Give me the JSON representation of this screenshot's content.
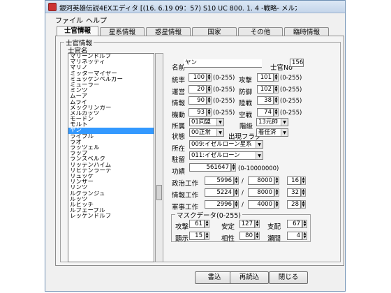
{
  "title": "銀河英雄伝説4EXエディタ [(16. 6.19 09：57) S10 UC 800. 1. 4 -戦略- メルカッ...",
  "menu": [
    "ファイル",
    "ヘルプ"
  ],
  "tabs": [
    "士官情報",
    "星系情報",
    "惑星情報",
    "国家",
    "その他",
    "臨時情報"
  ],
  "group_label": "士官情報",
  "list_header": "士官名",
  "officers": [
    "マリーンドルフ",
    "マリネッティ",
    "マリノ",
    "ミッターマイヤー",
    "ミュッケンベルガー",
    "ミューラー",
    "ミンツ",
    "ムーア",
    "ムライ",
    "メックリンガー",
    "メルカッツ",
    "モードン",
    "モルト",
    "ヤン",
    "ライブル",
    "ラオ",
    "ラッツェル",
    "ラップ",
    "ランズベルク",
    "リッテンハイム",
    "リヒテンラーデ",
    "リュッケ",
    "リンザー",
    "リンツ",
    "ルグランジュ",
    "ルッツ",
    "ルビッチ",
    "ルフェーブル",
    "レッケンドルフ"
  ],
  "selected_index": 13,
  "name_label": "名前",
  "name_value": "ヤン",
  "officer_no_label": "士官No",
  "officer_no": "156",
  "stats": [
    {
      "label": "統率",
      "value": "100",
      "range": "(0-255)"
    },
    {
      "label": "運営",
      "value": "20",
      "range": "(0-255)"
    },
    {
      "label": "情報",
      "value": "90",
      "range": "(0-255)"
    },
    {
      "label": "機動",
      "value": "93",
      "range": "(0-255)"
    }
  ],
  "stats2": [
    {
      "label": "攻撃",
      "value": "101",
      "range": "(0-255)"
    },
    {
      "label": "防御",
      "value": "102",
      "range": "(0-255)"
    },
    {
      "label": "陸戦",
      "value": "38",
      "range": "(0-255)"
    },
    {
      "label": "空戦",
      "value": "74",
      "range": "(0-255)"
    }
  ],
  "affiliation_label": "所属",
  "affiliation_value": "01同盟",
  "rank_label": "階級",
  "rank_value": "13元帥",
  "status_label": "状態",
  "status_value": "00正常",
  "sortie_label": "出現フラグ",
  "sortie_value": "着任済",
  "location_label": "所在",
  "location_value": "009:イゼルローン星系",
  "station_label": "駐留",
  "station_value": "011:イゼルローン",
  "merit_label": "功績",
  "merit_value": "561647",
  "merit_range": "(0-10000000)",
  "work": [
    {
      "label": "政治工作",
      "v1": "5996",
      "v2": "8000",
      "v3": "16"
    },
    {
      "label": "情報工作",
      "v1": "5224",
      "v2": "8000",
      "v3": "32"
    },
    {
      "label": "軍事工作",
      "v1": "2996",
      "v2": "4000",
      "v3": "28"
    }
  ],
  "mask_label": "マスクデータ(0-255)",
  "mask": [
    {
      "label": "攻撃",
      "value": "61"
    },
    {
      "label": "安定",
      "value": "127"
    },
    {
      "label": "支配",
      "value": "67"
    },
    {
      "label": "顕示",
      "value": "15"
    },
    {
      "label": "相性",
      "value": "80"
    },
    {
      "label": "瀬間",
      "value": "4"
    }
  ],
  "buttons": {
    "write": "書込",
    "reread": "再読込",
    "close": "閉じる"
  }
}
